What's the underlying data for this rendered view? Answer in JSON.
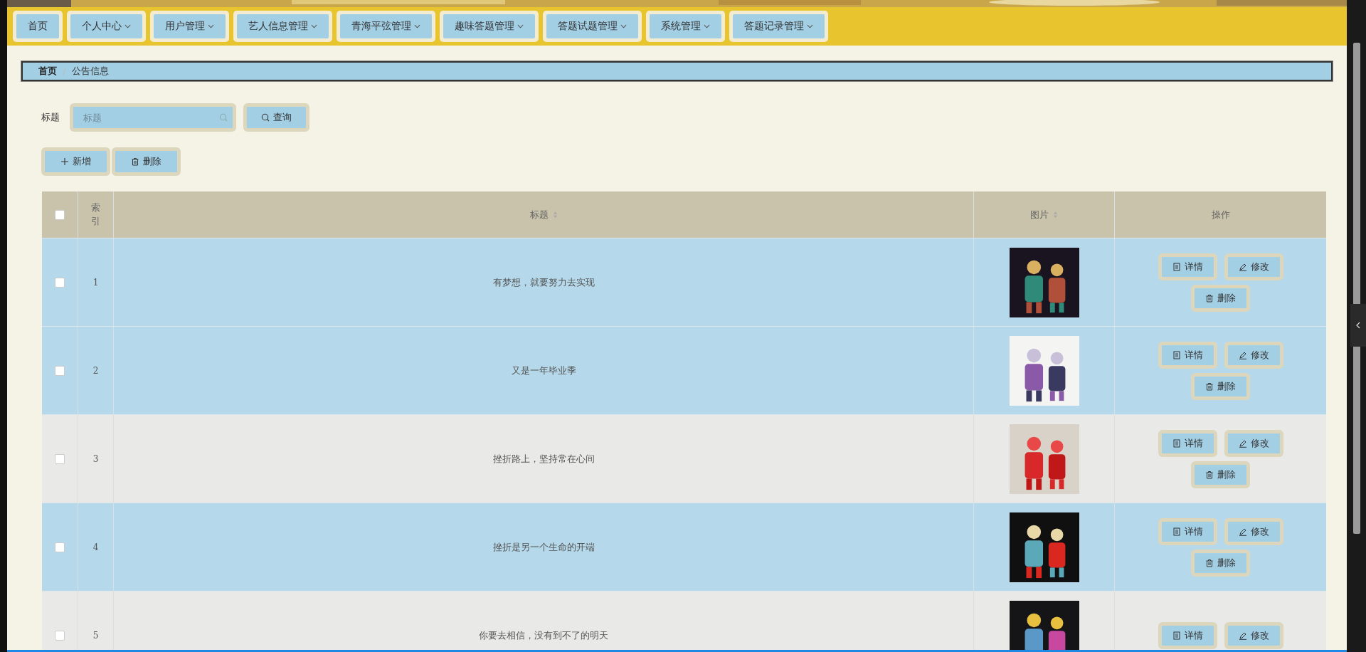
{
  "nav": [
    {
      "label": "首页",
      "dropdown": false
    },
    {
      "label": "个人中心",
      "dropdown": true
    },
    {
      "label": "用户管理",
      "dropdown": true
    },
    {
      "label": "艺人信息管理",
      "dropdown": true
    },
    {
      "label": "青海平弦管理",
      "dropdown": true
    },
    {
      "label": "趣味答题管理",
      "dropdown": true
    },
    {
      "label": "答题试题管理",
      "dropdown": true
    },
    {
      "label": "系统管理",
      "dropdown": true
    },
    {
      "label": "答题记录管理",
      "dropdown": true
    }
  ],
  "breadcrumb": [
    "首页",
    "公告信息"
  ],
  "search": {
    "label": "标题",
    "placeholder": "标题",
    "button": "查询"
  },
  "toolbar": [
    {
      "kind": "add",
      "label": "新增"
    },
    {
      "kind": "delete",
      "label": "删除"
    }
  ],
  "table": {
    "select_all_checked": false,
    "columns": [
      {
        "label": "索引",
        "sortable": false
      },
      {
        "label": "标题",
        "sortable": true
      },
      {
        "label": "图片",
        "sortable": true
      },
      {
        "label": "操作",
        "sortable": false
      }
    ],
    "rows": [
      {
        "index": "1",
        "title": "有梦想，就要努力去实现",
        "checked": false,
        "highlighted": true,
        "picture": {
          "kind": "picture"
        },
        "actions": [
          {
            "kind": "detail",
            "label": "详情"
          },
          {
            "kind": "edit",
            "label": "修改"
          },
          {
            "kind": "delete",
            "label": "删除"
          }
        ]
      },
      {
        "index": "2",
        "title": "又是一年毕业季",
        "checked": false,
        "highlighted": true,
        "picture": {
          "kind": "picture"
        },
        "actions": [
          {
            "kind": "detail",
            "label": "详情"
          },
          {
            "kind": "edit",
            "label": "修改"
          },
          {
            "kind": "delete",
            "label": "删除"
          }
        ]
      },
      {
        "index": "3",
        "title": "挫折路上，坚持常在心间",
        "checked": false,
        "highlighted": false,
        "picture": {
          "kind": "picture"
        },
        "actions": [
          {
            "kind": "detail",
            "label": "详情"
          },
          {
            "kind": "edit",
            "label": "修改"
          },
          {
            "kind": "delete",
            "label": "删除"
          }
        ]
      },
      {
        "index": "4",
        "title": "挫折是另一个生命的开端",
        "checked": false,
        "highlighted": true,
        "picture": {
          "kind": "picture"
        },
        "actions": [
          {
            "kind": "detail",
            "label": "详情"
          },
          {
            "kind": "edit",
            "label": "修改"
          },
          {
            "kind": "delete",
            "label": "删除"
          }
        ]
      },
      {
        "index": "5",
        "title": "你要去相信，没有到不了的明天",
        "checked": false,
        "highlighted": false,
        "picture": {
          "kind": "picture"
        },
        "actions": [
          {
            "kind": "detail",
            "label": "详情"
          },
          {
            "kind": "edit",
            "label": "修改"
          }
        ]
      }
    ]
  }
}
